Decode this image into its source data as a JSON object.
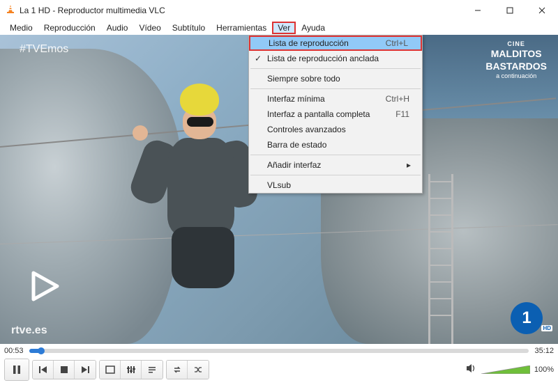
{
  "window": {
    "title": "La 1 HD - Reproductor multimedia VLC"
  },
  "menubar": {
    "items": [
      "Medio",
      "Reproducción",
      "Audio",
      "Vídeo",
      "Subtítulo",
      "Herramientas",
      "Ver",
      "Ayuda"
    ],
    "active_index": 6
  },
  "dropdown": {
    "items": [
      {
        "label": "Lista de reproducción",
        "shortcut": "Ctrl+L",
        "checked": false,
        "highlighted": true
      },
      {
        "label": "Lista de reproducción anclada",
        "shortcut": "",
        "checked": true,
        "highlighted": false
      },
      {
        "sep": true
      },
      {
        "label": "Siempre sobre todo",
        "shortcut": "",
        "checked": false
      },
      {
        "sep": true
      },
      {
        "label": "Interfaz mínima",
        "shortcut": "Ctrl+H",
        "checked": false
      },
      {
        "label": "Interfaz a pantalla completa",
        "shortcut": "F11",
        "checked": false
      },
      {
        "label": "Controles avanzados",
        "shortcut": "",
        "checked": false
      },
      {
        "label": "Barra de estado",
        "shortcut": "",
        "checked": false
      },
      {
        "sep": true
      },
      {
        "label": "Añadir interfaz",
        "shortcut": "",
        "submenu": true
      },
      {
        "sep": true
      },
      {
        "label": "VLsub",
        "shortcut": "",
        "checked": false
      }
    ]
  },
  "overlay": {
    "hashtag": "#TVEmos",
    "cine_top": "CINE",
    "cine_title1": "MALDITOS",
    "cine_title2": "BASTARDOS",
    "cine_sub": "a continuación",
    "rtve": "rtve.es",
    "channel_number": "1",
    "channel_hd": "HD"
  },
  "playback": {
    "elapsed": "00:53",
    "total": "35:12",
    "progress_pct": 2.5,
    "volume_pct_label": "100%",
    "volume_pct": 100
  },
  "icons": {
    "pause": "pause-icon",
    "prev": "previous-icon",
    "stop": "stop-icon",
    "next": "next-icon",
    "fullscreen": "fullscreen-icon",
    "ext": "extended-settings-icon",
    "playlist": "playlist-icon",
    "loop": "loop-icon",
    "shuffle": "shuffle-icon",
    "speaker": "speaker-icon"
  }
}
